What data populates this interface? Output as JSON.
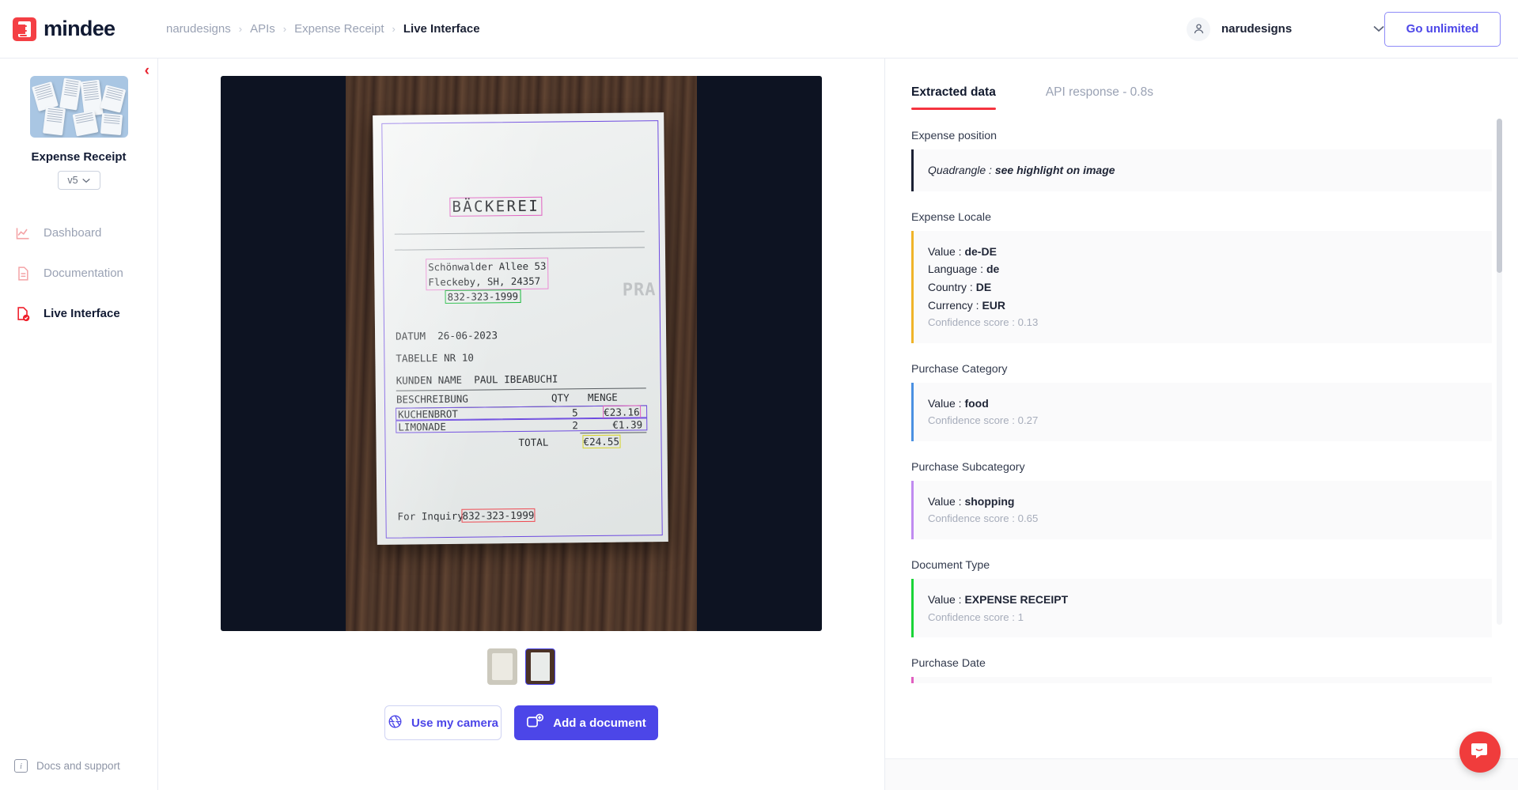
{
  "brand": {
    "name": "mindee",
    "logo_color": "#f43f44"
  },
  "breadcrumb": [
    {
      "label": "narudesigns"
    },
    {
      "label": "APIs"
    },
    {
      "label": "Expense Receipt"
    },
    {
      "label": "Live Interface"
    }
  ],
  "breadcrumb_separator": "›",
  "account": {
    "name": "narudesigns",
    "caret": "⌄",
    "icon": "user-icon"
  },
  "go_unlimited_label": "Go unlimited",
  "sidebar": {
    "model_name": "Expense Receipt",
    "version": "v5",
    "collapse_icon": "‹",
    "items": [
      {
        "label": "Dashboard",
        "icon": "chart-line-icon",
        "active": false
      },
      {
        "label": "Documentation",
        "icon": "document-icon",
        "active": false
      },
      {
        "label": "Live Interface",
        "icon": "document-check-icon",
        "active": true
      }
    ],
    "footer": {
      "label": "Docs and support",
      "icon": "info-icon"
    }
  },
  "viewer": {
    "receipt": {
      "title": "BÄCKEREI",
      "address_line1": "Schönwalder Allee 53",
      "address_line2": "Fleckeby, SH, 24357",
      "phone": "832-323-1999",
      "watermark": "PRA",
      "date_line": "DATUM  26-06-2023",
      "table_line": "TABELLE NR 10",
      "customer_line": "KUNDEN NAME  PAUL IBEABUCHI",
      "columns": {
        "desc": "BESCHREIBUNG",
        "qty": "QTY",
        "amount": "MENGE"
      },
      "items": [
        {
          "desc": "KUCHENBROT",
          "qty": "5",
          "amount": "€23.16"
        },
        {
          "desc": "LIMONADE",
          "qty": "2",
          "amount": "€1.39"
        }
      ],
      "total_label": "TOTAL",
      "total_amount": "€24.55",
      "inquiry_label": "For Inquiry",
      "inquiry_phone": "832-323-1999"
    },
    "thumbnails": [
      {
        "name": "page-1",
        "selected": false
      },
      {
        "name": "page-2",
        "selected": true
      }
    ],
    "buttons": {
      "camera": {
        "label": "Use my camera",
        "icon": "aperture-icon"
      },
      "add": {
        "label": "Add a document",
        "icon": "add-document-icon"
      }
    }
  },
  "panel": {
    "tabs": [
      {
        "label": "Extracted data",
        "active": true
      },
      {
        "label": "API response - 0.8s",
        "active": false
      }
    ],
    "fields": [
      {
        "label": "Expense position",
        "accent": "#1b2134",
        "rows": [
          {
            "key": "Quadrangle",
            "value": "see highlight on image",
            "italic": true
          }
        ],
        "confidence": null
      },
      {
        "label": "Expense Locale",
        "accent": "#f0b429",
        "rows": [
          {
            "key": "Value",
            "value": "de-DE"
          },
          {
            "key": "Language",
            "value": "de"
          },
          {
            "key": "Country",
            "value": "DE"
          },
          {
            "key": "Currency",
            "value": "EUR"
          }
        ],
        "confidence": "Confidence score : 0.13"
      },
      {
        "label": "Purchase Category",
        "accent": "#4a90e2",
        "rows": [
          {
            "key": "Value",
            "value": "food"
          }
        ],
        "confidence": "Confidence score : 0.27"
      },
      {
        "label": "Purchase Subcategory",
        "accent": "#c08bf0",
        "rows": [
          {
            "key": "Value",
            "value": "shopping"
          }
        ],
        "confidence": "Confidence score : 0.65"
      },
      {
        "label": "Document Type",
        "accent": "#19d437",
        "rows": [
          {
            "key": "Value",
            "value": "EXPENSE RECEIPT"
          }
        ],
        "confidence": "Confidence score : 1"
      },
      {
        "label": "Purchase Date",
        "accent": "#e05fc0",
        "rows": [],
        "confidence": null
      }
    ]
  },
  "chat": {
    "icon": "chat-bubble-icon",
    "color": "#f03c3c"
  }
}
